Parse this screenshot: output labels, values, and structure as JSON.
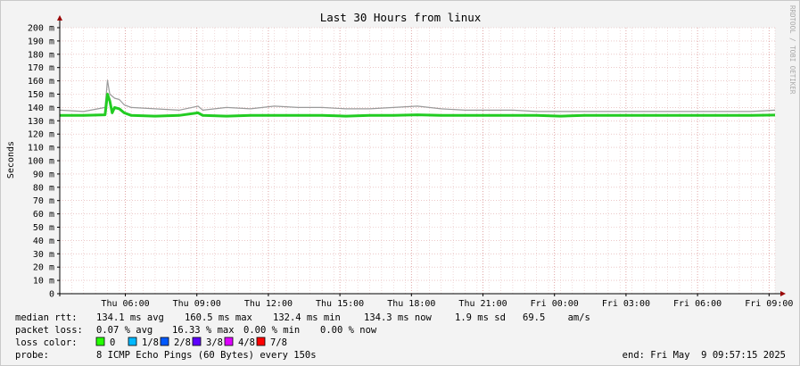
{
  "watermark": "RRDTOOL / TOBI OETIKER",
  "chart_data": {
    "type": "line",
    "title": "Last 30 Hours from linux",
    "ylabel": "Seconds",
    "ylim": [
      0,
      200
    ],
    "y_ticks": [
      {
        "v": 0,
        "label": "0"
      },
      {
        "v": 10,
        "label": "10 m"
      },
      {
        "v": 20,
        "label": "20 m"
      },
      {
        "v": 30,
        "label": "30 m"
      },
      {
        "v": 40,
        "label": "40 m"
      },
      {
        "v": 50,
        "label": "50 m"
      },
      {
        "v": 60,
        "label": "60 m"
      },
      {
        "v": 70,
        "label": "70 m"
      },
      {
        "v": 80,
        "label": "80 m"
      },
      {
        "v": 90,
        "label": "90 m"
      },
      {
        "v": 100,
        "label": "100 m"
      },
      {
        "v": 110,
        "label": "110 m"
      },
      {
        "v": 120,
        "label": "120 m"
      },
      {
        "v": 130,
        "label": "130 m"
      },
      {
        "v": 140,
        "label": "140 m"
      },
      {
        "v": 150,
        "label": "150 m"
      },
      {
        "v": 160,
        "label": "160 m"
      },
      {
        "v": 170,
        "label": "170 m"
      },
      {
        "v": 180,
        "label": "180 m"
      },
      {
        "v": 190,
        "label": "190 m"
      },
      {
        "v": 200,
        "label": "200 m"
      }
    ],
    "x_domain_hours": [
      0,
      30
    ],
    "x_ticks": [
      {
        "h": 2.75,
        "label": "Thu 06:00"
      },
      {
        "h": 5.75,
        "label": "Thu 09:00"
      },
      {
        "h": 8.75,
        "label": "Thu 12:00"
      },
      {
        "h": 11.75,
        "label": "Thu 15:00"
      },
      {
        "h": 14.75,
        "label": "Thu 18:00"
      },
      {
        "h": 17.75,
        "label": "Thu 21:00"
      },
      {
        "h": 20.75,
        "label": "Fri 00:00"
      },
      {
        "h": 23.75,
        "label": "Fri 03:00"
      },
      {
        "h": 26.75,
        "label": "Fri 06:00"
      },
      {
        "h": 29.75,
        "label": "Fri 09:00"
      }
    ],
    "grid": true,
    "series": [
      {
        "name": "median rtt",
        "color": "#22cc22",
        "x": [
          0.0,
          1.0,
          1.9,
          2.0,
          2.1,
          2.2,
          2.3,
          2.5,
          2.7,
          3.0,
          4.0,
          5.0,
          5.8,
          6.0,
          7.0,
          8.0,
          9.0,
          10.0,
          11.0,
          12.0,
          13.0,
          14.0,
          15.0,
          16.0,
          17.0,
          18.0,
          19.0,
          20.0,
          21.0,
          22.0,
          23.0,
          24.0,
          25.0,
          26.0,
          27.0,
          28.0,
          29.0,
          30.0
        ],
        "y": [
          134.0,
          134.0,
          134.5,
          150.0,
          145.0,
          136.0,
          140.0,
          139.0,
          136.0,
          134.0,
          133.5,
          134.0,
          136.0,
          134.0,
          133.5,
          134.0,
          134.0,
          134.0,
          134.0,
          133.5,
          134.0,
          134.0,
          134.5,
          134.0,
          134.0,
          134.0,
          134.0,
          134.0,
          133.5,
          134.0,
          134.0,
          134.0,
          134.0,
          134.0,
          134.0,
          134.0,
          134.0,
          134.3
        ]
      },
      {
        "name": "rtt max",
        "color": "#9a9a9a",
        "x": [
          0.0,
          1.0,
          1.9,
          2.0,
          2.1,
          2.3,
          2.5,
          2.7,
          3.0,
          4.0,
          5.0,
          5.8,
          6.0,
          7.0,
          8.0,
          9.0,
          10.0,
          11.0,
          12.0,
          13.0,
          14.0,
          15.0,
          16.0,
          17.0,
          18.0,
          19.0,
          20.0,
          21.0,
          22.0,
          23.0,
          24.0,
          25.0,
          26.0,
          27.0,
          28.0,
          29.0,
          30.0
        ],
        "y": [
          138.0,
          137.0,
          140.0,
          160.5,
          150.0,
          147.0,
          146.0,
          142.0,
          140.0,
          139.0,
          138.0,
          141.0,
          138.0,
          140.0,
          139.0,
          141.0,
          140.0,
          140.0,
          139.0,
          139.0,
          140.0,
          141.0,
          139.0,
          138.0,
          138.0,
          138.0,
          137.0,
          137.0,
          137.0,
          137.0,
          137.0,
          137.0,
          137.0,
          137.0,
          137.0,
          137.0,
          138.0
        ]
      }
    ],
    "legend": {
      "rtt": {
        "label": "median rtt:",
        "avg": "134.1 ms avg",
        "max": "160.5 ms max",
        "min": "132.4 ms min",
        "now": "134.3 ms now",
        "sd": "1.9 ms sd",
        "ams": "69.5    am/s"
      },
      "loss": {
        "label": "packet loss:",
        "avg": "0.07 % avg",
        "max": "16.33 % max",
        "min": "0.00 % min",
        "now": "0.00 % now"
      },
      "loss_color": {
        "label": "loss color:",
        "items": [
          {
            "label": "0",
            "color": "#26ff00"
          },
          {
            "label": "1/8",
            "color": "#00b8ff"
          },
          {
            "label": "2/8",
            "color": "#0059ff"
          },
          {
            "label": "3/8",
            "color": "#5e00ff"
          },
          {
            "label": "4/8",
            "color": "#dd00ff"
          },
          {
            "label": "7/8",
            "color": "#ff0000"
          }
        ]
      },
      "probe": {
        "label": "probe:",
        "text": "8 ICMP Echo Pings (60 Bytes) every 150s",
        "end": "end: Fri May  9 09:57:15 2025"
      }
    }
  }
}
